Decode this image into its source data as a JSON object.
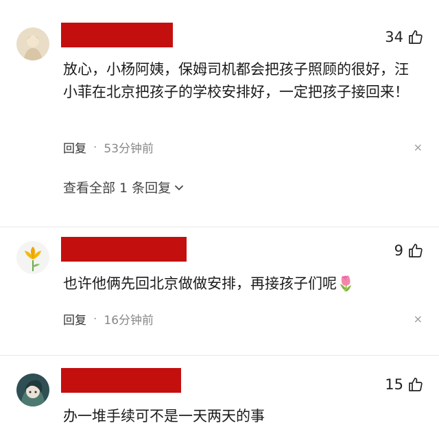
{
  "comments": [
    {
      "likes": "34",
      "text": "放心，小杨阿姨，保姆司机都会把孩子照顾的很好，汪小菲在北京把孩子的学校安排好，一定把孩子接回来！",
      "reply_label": "回复",
      "dot": "·",
      "time": "53分钟前",
      "close": "×",
      "view_replies": "查看全部 1 条回复"
    },
    {
      "likes": "9",
      "text": "也许他俩先回北京做做安排，再接孩子们呢",
      "emoji": "🌷",
      "reply_label": "回复",
      "dot": "·",
      "time": "16分钟前",
      "close": "×"
    },
    {
      "likes": "15",
      "text": "办一堆手续可不是一天两天的事"
    }
  ],
  "colors": {
    "redacted_name": "#c40f0f",
    "divider": "#e8e8e8",
    "muted_text": "#888888"
  },
  "icons": {
    "like": "thumbs-up-icon",
    "dismiss": "close-icon",
    "expand": "chevron-down-icon"
  }
}
